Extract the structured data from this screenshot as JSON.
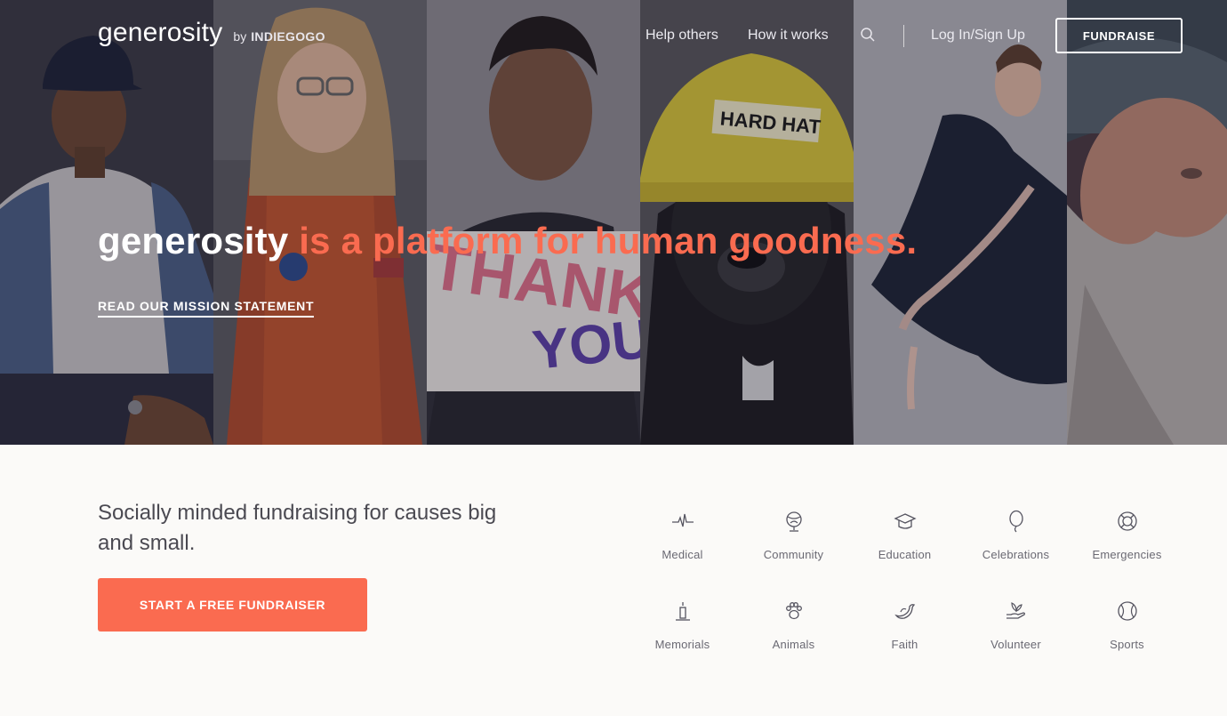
{
  "header": {
    "logo_word": "generosity",
    "logo_by": "by",
    "logo_brand": "INDIEGOGO",
    "nav": {
      "help_others": "Help others",
      "how_it_works": "How it works",
      "login": "Log In/Sign Up",
      "fundraise": "FUNDRAISE"
    }
  },
  "hero": {
    "headline_brand": "generosity",
    "headline_rest": " is a platform for human goodness.",
    "mission_link": "READ OUR MISSION STATEMENT",
    "sign_text_1": "THANK",
    "sign_text_2": "YOU",
    "hat_text": "HARD HAT"
  },
  "main": {
    "tagline": "Socially minded fundraising for causes big and small.",
    "start_button": "START A FREE FUNDRAISER"
  },
  "categories": [
    {
      "label": "Medical",
      "icon": "heartbeat-icon"
    },
    {
      "label": "Community",
      "icon": "globe-icon"
    },
    {
      "label": "Education",
      "icon": "graduation-cap-icon"
    },
    {
      "label": "Celebrations",
      "icon": "balloon-icon"
    },
    {
      "label": "Emergencies",
      "icon": "lifebuoy-icon"
    },
    {
      "label": "Memorials",
      "icon": "candle-icon"
    },
    {
      "label": "Animals",
      "icon": "paw-icon"
    },
    {
      "label": "Faith",
      "icon": "dove-icon"
    },
    {
      "label": "Volunteer",
      "icon": "helping-hand-icon"
    },
    {
      "label": "Sports",
      "icon": "ball-icon"
    }
  ],
  "colors": {
    "accent": "#fa6b50",
    "text_dark": "#4b4a52",
    "text_muted": "#6a6973",
    "page_bg": "#fbfaf8"
  }
}
